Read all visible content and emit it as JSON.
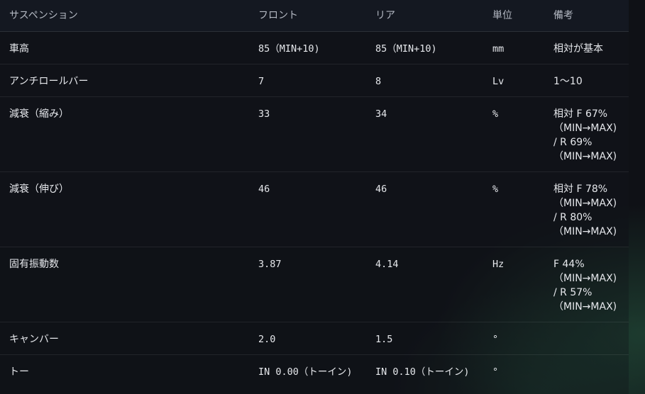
{
  "header": {
    "col1": "サスペンション",
    "col2": "フロント",
    "col3": "リア",
    "col4": "単位",
    "col5": "備考"
  },
  "rows": [
    {
      "label": "車高",
      "front": "85（MIN+10)",
      "rear": "85（MIN+10)",
      "unit": "mm",
      "notes": [
        "相対が基本"
      ]
    },
    {
      "label": "アンチロールバー",
      "front": "7",
      "rear": "8",
      "unit": "Lv",
      "notes": [
        "1〜10"
      ]
    },
    {
      "label": "減衰（縮み）",
      "front": "33",
      "rear": "34",
      "unit": "%",
      "notes": [
        "相対 F 67%",
        "（MIN→MAX)",
        "/ R 69%",
        "（MIN→MAX)"
      ]
    },
    {
      "label": "減衰（伸び）",
      "front": "46",
      "rear": "46",
      "unit": "%",
      "notes": [
        "相対 F 78%",
        "（MIN→MAX)",
        "/ R 80%",
        "（MIN→MAX)"
      ]
    },
    {
      "label": "固有振動数",
      "front": "3.87",
      "rear": "4.14",
      "unit": "Hz",
      "notes": [
        "F 44%",
        "（MIN→MAX)",
        "/ R 57%",
        "（MIN→MAX)"
      ]
    },
    {
      "label": "キャンバー",
      "front": "2.0",
      "rear": "1.5",
      "unit": "°",
      "notes": [
        ""
      ]
    },
    {
      "label": "トー",
      "front": "IN 0.00（トーイン)",
      "rear": "IN 0.10（トーイン)",
      "unit": "°",
      "notes": [
        ""
      ]
    }
  ]
}
